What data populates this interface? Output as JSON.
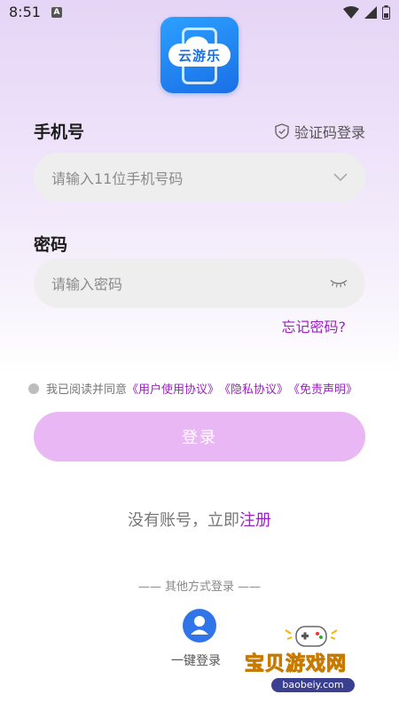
{
  "status_bar": {
    "time": "8:51",
    "a_badge": "A"
  },
  "logo": {
    "text": "云游乐"
  },
  "form": {
    "phone_label": "手机号",
    "sms_login": "验证码登录",
    "phone_placeholder": "请输入11位手机号码",
    "password_label": "密码",
    "password_placeholder": "请输入密码",
    "forgot": "忘记密码?"
  },
  "agreement": {
    "prefix": "我已阅读并同意",
    "links": [
      "《用户使用协议》",
      "《隐私协议》",
      "《免责声明》"
    ]
  },
  "login_button": "登录",
  "register": {
    "prefix": "没有账号，立即",
    "link": "注册"
  },
  "other_login": {
    "title": "—— 其他方式登录 ——",
    "onekey": "一键登录"
  },
  "watermark": {
    "text": "宝贝游戏网",
    "url": "baobeiy.com"
  },
  "colors": {
    "accent": "#9b22c4",
    "button": "#e9b7f4",
    "logo": "#1a6fe6"
  }
}
